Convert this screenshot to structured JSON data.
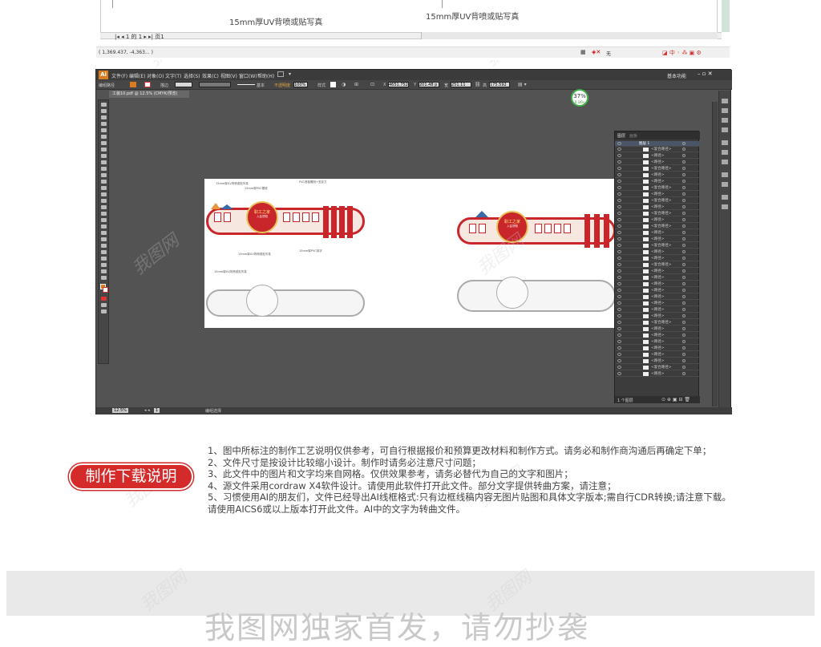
{
  "coreldraw": {
    "captions": [
      "15mm厚UV背喷或贴写真",
      "15mm厚UV背喷或贴写真"
    ],
    "page_tabs": "|◂ ◂ 1 的 1 ▸ ▸| 页1",
    "coords": "( 1,369.437, -4,363... )",
    "status_right": "无"
  },
  "ai": {
    "logo": "Ai",
    "menu": [
      "文件(F)",
      "编辑(E)",
      "对象(O)",
      "文字(T)",
      "选择(S)",
      "效果(C)",
      "视图(V)",
      "窗口(W)",
      "帮助(H)"
    ],
    "workspace": "基本功能",
    "ctrl": {
      "selection": "编组路径",
      "stroke_label": "描边",
      "stroke_width": "基本",
      "opacity_label": "不透明度",
      "opacity": "100%",
      "style_label": "样式",
      "x": "4651.752",
      "y": "201.48 p",
      "w": "251.11",
      "h": "175.592"
    },
    "tab": "工装10.pdf @ 12.5% (CMYK/预览)",
    "zoom_badge": {
      "pct": "37%",
      "sub": "0.1K/s"
    },
    "layers": {
      "tabs": [
        "图层",
        "画板"
      ],
      "top_layer": "图层 1",
      "rows": [
        "<复合路径>",
        "<路径>",
        "<路径>",
        "<复合路径>",
        "<路径>",
        "<路径>",
        "<复合路径>",
        "<路径>",
        "<复合路径>",
        "<路径>",
        "<复合路径>",
        "<路径>",
        "<复合路径>",
        "<路径>",
        "<路径>",
        "<复合路径>",
        "<路径>",
        "<路径>",
        "<复合路径>",
        "<路径>",
        "<路径>",
        "<路径>",
        "<路径>",
        "<路径>",
        "<路径>",
        "<路径>",
        "<路径>",
        "<复合路径>",
        "<路径>",
        "<路径>",
        "<路径>",
        "<路径>",
        "<路径>",
        "<路径>",
        "<复合路径>",
        "<路径>"
      ],
      "footer": "1 个图层"
    },
    "status": {
      "zoom": "12.5%",
      "page": "1",
      "mode": "编组选择"
    },
    "art": {
      "title_left": "职工之家",
      "title_right": "职工之家",
      "sub": "入会须知",
      "labels": [
        "15mm厚UV背喷或贴写真",
        "15mm厚PVC基底",
        "PVC底板雕刻+亚克力",
        "15mm厚UV背喷或贴写真",
        "15mm厚PVC刻字",
        "15mm厚UV背喷或贴写真"
      ]
    }
  },
  "notes": {
    "badge": "制作下载说明",
    "lines": [
      "1、图中所标注的制作工艺说明仅供参考，可自行根据报价和预算更改材料和制作方式。请务必和制作商沟通后再确定下单；",
      "2、文件尺寸是按设计比较缩小设计。制作时请务必注意尺寸问题；",
      "3、此文件中的图片和文字均来自网格。仅供效果参考，请务必替代为自己的文字和图片；",
      "4、源文件采用cordraw X4软件设计。请使用此软件打开此文件。部分文字提供转曲方案，请注意；",
      "5、习惯使用AI的朋友们，文件已经导出AI线框格式:只有边框线稿内容无图片贴图和具体文字版本;需自行CDR转换;请注意下载。",
      "请使用AICS6或以上版本打开此文件。AI中的文字为转曲文件。"
    ]
  },
  "footer": {
    "text": "我图网独家首发，请勿抄袭"
  },
  "watermark": "我图网"
}
